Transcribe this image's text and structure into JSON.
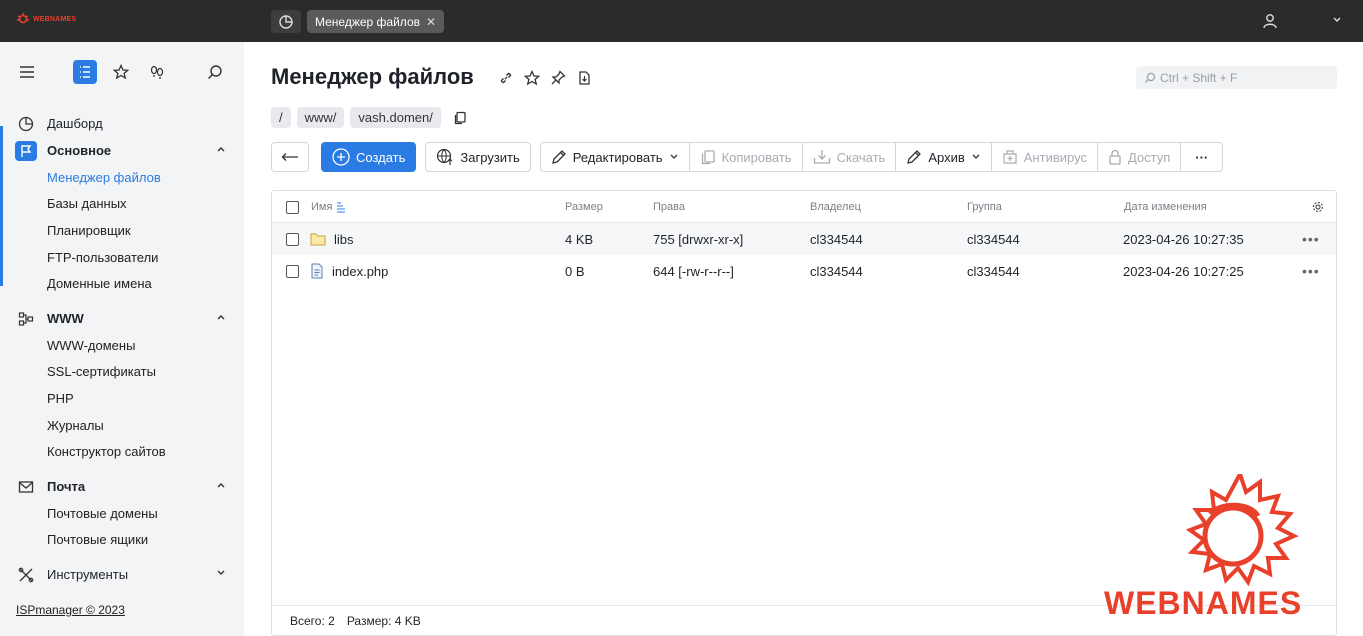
{
  "topbar": {
    "logo_text": "WEBNAMES",
    "tab_label": "Менеджер файлов"
  },
  "sidebar": {
    "items": [
      {
        "label": "Дашборд"
      }
    ],
    "sections": [
      {
        "title": "Основное",
        "items": [
          "Менеджер файлов",
          "Базы данных",
          "Планировщик",
          "FTP-пользователи",
          "Доменные имена"
        ]
      },
      {
        "title": "WWW",
        "items": [
          "WWW-домены",
          "SSL-сертификаты",
          "PHP",
          "Журналы",
          "Конструктор сайтов"
        ]
      },
      {
        "title": "Почта",
        "items": [
          "Почтовые домены",
          "Почтовые ящики"
        ]
      },
      {
        "title": "Инструменты",
        "items": []
      }
    ],
    "copyright": "ISPmanager © 2023"
  },
  "main": {
    "title": "Менеджер файлов",
    "search_placeholder": "Ctrl + Shift + F",
    "breadcrumbs": [
      "/",
      "www/",
      "vash.domen/"
    ],
    "toolbar": {
      "create": "Создать",
      "upload": "Загрузить",
      "edit": "Редактировать",
      "copy": "Копировать",
      "download": "Скачать",
      "archive": "Архив",
      "antivirus": "Антивирус",
      "access": "Доступ",
      "more": "···"
    },
    "table": {
      "columns": [
        "Имя",
        "Размер",
        "Права",
        "Владелец",
        "Группа",
        "Дата изменения"
      ],
      "rows": [
        {
          "name": "libs",
          "size": "4 KB",
          "perms": "755 [drwxr-xr-x]",
          "owner": "cl334544",
          "group": "cl334544",
          "modified": "2023-04-26 10:27:35",
          "type": "folder"
        },
        {
          "name": "index.php",
          "size": "0 B",
          "perms": "644 [-rw-r--r--]",
          "owner": "cl334544",
          "group": "cl334544",
          "modified": "2023-04-26 10:27:25",
          "type": "file"
        }
      ],
      "footer_total": "Всего: 2",
      "footer_size": "Размер: 4 KB"
    }
  },
  "watermark": {
    "text": "WEBNAMES"
  },
  "colors": {
    "accent": "#2b7be4",
    "brand": "#e8402a",
    "topbar": "#2b2b2b",
    "sidebar": "#f3f4f6"
  }
}
